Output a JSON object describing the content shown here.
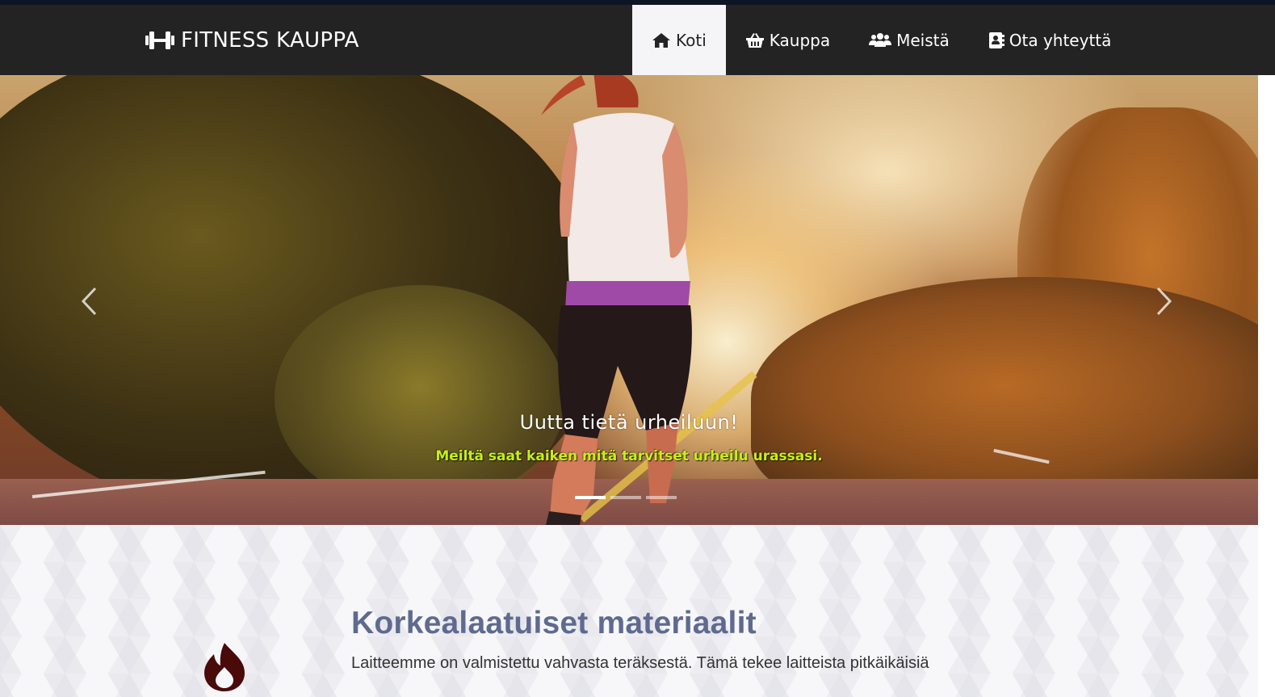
{
  "brand": {
    "name": "FITNESS KAUPPA",
    "icon": "dumbbell-icon"
  },
  "nav": {
    "items": [
      {
        "label": "Koti",
        "icon": "home-icon",
        "active": true
      },
      {
        "label": "Kauppa",
        "icon": "basket-icon",
        "active": false
      },
      {
        "label": "Meistä",
        "icon": "users-icon",
        "active": false
      },
      {
        "label": "Ota yhteyttä",
        "icon": "address-book-icon",
        "active": false
      }
    ]
  },
  "carousel": {
    "caption_title": "Uutta tietä urheiluun!",
    "caption_subtitle": "Meiltä saat kaiken mitä tarvitset urheilu urassasi.",
    "slide_count": 3,
    "active_slide": 1
  },
  "feature": {
    "icon": "fire-icon",
    "title": "Korkealaatuiset materiaalit",
    "text": "Laitteemme on valmistettu vahvasta teräksestä. Tämä tekee laitteista pitkäikäisiä"
  },
  "colors": {
    "navbar": "#232323",
    "active_nav": "#f5f5f7",
    "caption_subtitle": "#c6f016",
    "feature_title": "#5f6a8f",
    "fire_icon": "#4a0a0a"
  }
}
